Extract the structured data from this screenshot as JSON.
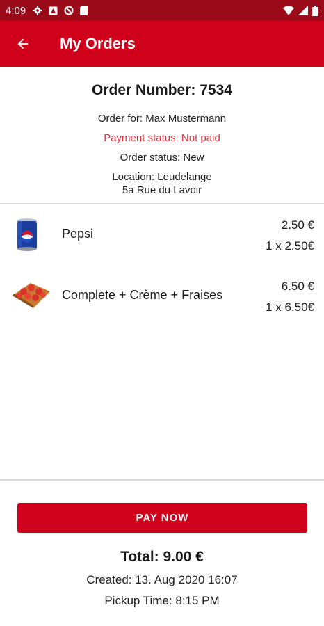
{
  "status_bar": {
    "time": "4:09"
  },
  "app_bar": {
    "title": "My Orders"
  },
  "order": {
    "number_label": "Order Number: 7534",
    "customer": "Order for: Max Mustermann",
    "payment_status": "Payment status: Not paid",
    "order_status": "Order status: New",
    "location_line1": "Location: Leudelange",
    "location_line2": "5a Rue du Lavoir"
  },
  "items": [
    {
      "name": "Pepsi",
      "price": "2.50 €",
      "qty_price": "1 x 2.50€",
      "icon": "pepsi-can-icon"
    },
    {
      "name": "Complete + Crème + Fraises",
      "price": "6.50 €",
      "qty_price": "1 x 6.50€",
      "icon": "crepe-icon"
    }
  ],
  "footer": {
    "pay_button": "PAY NOW",
    "total": "Total: 9.00 €",
    "created": "Created: 13. Aug 2020 16:07",
    "pickup": "Pickup Time: 8:15 PM"
  },
  "colors": {
    "primary": "#d0021b",
    "status_bar": "#9b0a18",
    "payment_warning": "#e0333f"
  }
}
